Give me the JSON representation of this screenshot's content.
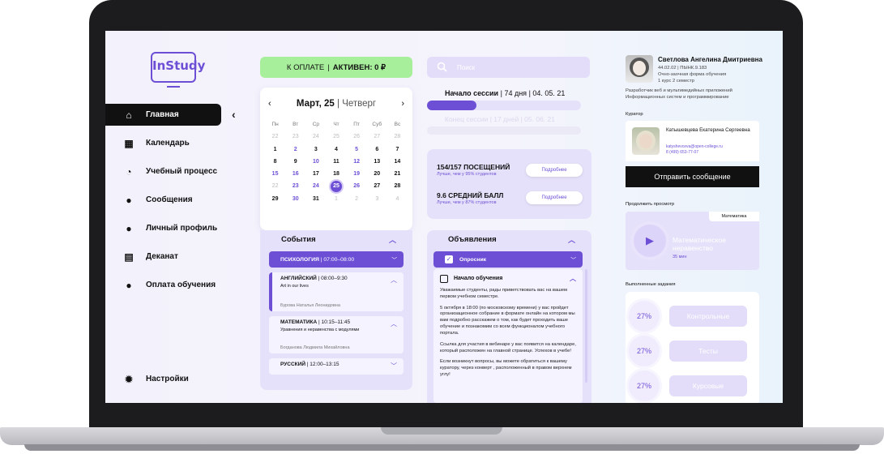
{
  "app": {
    "logo": "InStudy"
  },
  "sidebar": {
    "items": [
      {
        "label": "Главная",
        "icon": "home-icon",
        "glyph": "⌂"
      },
      {
        "label": "Календарь",
        "icon": "calendar-icon",
        "glyph": "▦"
      },
      {
        "label": "Учебный процесс",
        "icon": "progress-ring-icon",
        "glyph": "◔"
      },
      {
        "label": "Сообщения",
        "icon": "message-icon",
        "glyph": "●"
      },
      {
        "label": "Личный профиль",
        "icon": "user-icon",
        "glyph": "●"
      },
      {
        "label": "Деканат",
        "icon": "documents-icon",
        "glyph": "▤"
      },
      {
        "label": "Оплата обучения",
        "icon": "payment-icon",
        "glyph": "●"
      }
    ],
    "settings_label": "Настройки",
    "collapse_glyph": "‹"
  },
  "payment": {
    "due_label": "К ОПЛАТЕ",
    "active_label": "АКТИВЕН: 0 ₽"
  },
  "calendar": {
    "month_day": "Март, 25",
    "weekday": "Четверг",
    "prev": "‹",
    "next": "›",
    "day_names": [
      "Пн",
      "Вт",
      "Ср",
      "Чт",
      "Пт",
      "Суб",
      "Вс"
    ],
    "rows": [
      [
        [
          "22",
          "m"
        ],
        [
          "23",
          "m"
        ],
        [
          "24",
          "m"
        ],
        [
          "25",
          "m"
        ],
        [
          "26",
          "m"
        ],
        [
          "27",
          "m"
        ],
        [
          "28",
          "m"
        ]
      ],
      [
        [
          "1",
          ""
        ],
        [
          "2",
          "p"
        ],
        [
          "3",
          ""
        ],
        [
          "4",
          ""
        ],
        [
          "5",
          "p"
        ],
        [
          "6",
          ""
        ],
        [
          "7",
          ""
        ]
      ],
      [
        [
          "8",
          ""
        ],
        [
          "9",
          ""
        ],
        [
          "10",
          "p"
        ],
        [
          "11",
          ""
        ],
        [
          "12",
          "p"
        ],
        [
          "13",
          ""
        ],
        [
          "14",
          ""
        ]
      ],
      [
        [
          "15",
          "p"
        ],
        [
          "16",
          "p"
        ],
        [
          "17",
          ""
        ],
        [
          "18",
          ""
        ],
        [
          "19",
          "p"
        ],
        [
          "20",
          ""
        ],
        [
          "21",
          ""
        ]
      ],
      [
        [
          "22",
          "m"
        ],
        [
          "23",
          "p"
        ],
        [
          "24",
          "p"
        ],
        [
          "25",
          "today"
        ],
        [
          "26",
          "p"
        ],
        [
          "27",
          ""
        ],
        [
          "28",
          ""
        ]
      ],
      [
        [
          "29",
          ""
        ],
        [
          "30",
          "p"
        ],
        [
          "31",
          ""
        ],
        [
          "1",
          "m"
        ],
        [
          "2",
          "m"
        ],
        [
          "3",
          "m"
        ],
        [
          "4",
          "m"
        ]
      ]
    ]
  },
  "events": {
    "title": "События",
    "active": {
      "subject": "ПСИХОЛОГИЯ",
      "time": " | 07:00–08:00"
    },
    "cards": [
      {
        "subject": "АНГЛИЙСКИЙ",
        "time": " | 08:00–9:30",
        "desc": "Art in our lives",
        "teacher": "Бурова Наталья Леонидовна"
      },
      {
        "subject": "МАТЕМАТИКА",
        "time": " | 10:15–11:45",
        "desc": "Уравнения и неравенства с модулями",
        "teacher": "Богданова Людмила Михайловна"
      },
      {
        "subject": "РУССКИЙ",
        "time": " | 12:00–13:15",
        "desc": "",
        "teacher": ""
      }
    ]
  },
  "search": {
    "placeholder": "Поиск"
  },
  "session": {
    "label": "Начало сессии",
    "days": "74 дня",
    "date": "04. 05. 21",
    "progress": 0.32,
    "label2": "Конец сессии",
    "days2": "17 дней",
    "date2": "05. 06. 21"
  },
  "stats": {
    "attendance": "154/157 ПОСЕЩЕНИЙ",
    "attendance_sub": "Лучше, чем у 95% студентов",
    "gpa": "9.6 СРЕДНИЙ БАЛЛ",
    "gpa_sub": "Лучше, чем у 87% студентов",
    "more": "Подробнее"
  },
  "announcements": {
    "title": "Объявления",
    "active": "Опросник",
    "card_title": "Начало обучения",
    "paragraphs": [
      "Уважаемые студенты, рады приветствовать вас на вашем первом учебном семестре.",
      "5 октября в 18:00 (по московскому времени) у вас пройдет организационное собрание в формате онлайн на котором мы вам подробно расскажем о том, как будет проходить ваше обучение и познакомим со всем функционалом учебного портала.",
      "Ссылка для участия в вебинаре у вас появится на календаре, который расположен на главной странице. Успехов в учебе!",
      "Если возникнут вопросы, вы можете обратиться к вашему куратору, через конверт , расположенный в правом верхнем углу!"
    ]
  },
  "profile": {
    "name": "Светлова Ангелина Дмитриевна",
    "line1": "44.02.02 | ПЫНК.9.183",
    "line2": "Очно-заочная форма обучения",
    "line3": "1 курс 2 семестр",
    "speciality": "Разработчик веб и мультимедийных приложений Информационных систем и программирование"
  },
  "curator": {
    "label": "Куратор",
    "name": "Катышевцева Екатерина Сергеевна",
    "email": "katyshevceva@open-college.ru",
    "phone": "8 (499) 653-77-07",
    "send": "Отправить сообщение"
  },
  "continue": {
    "label": "Продолжить просмотр",
    "tag": "Математика",
    "title": "Математическое неравенство",
    "duration": "35 мин"
  },
  "tasks": {
    "label": "Выполненные задания",
    "items": [
      {
        "percent": "27%",
        "label": "Контрольные"
      },
      {
        "percent": "27%",
        "label": "Тесты"
      },
      {
        "percent": "27%",
        "label": "Курсовые"
      }
    ]
  },
  "colors": {
    "accent": "#6d4fd6",
    "payment_green": "#a8ef9c",
    "panel_lavender": "#e6e1fa"
  }
}
